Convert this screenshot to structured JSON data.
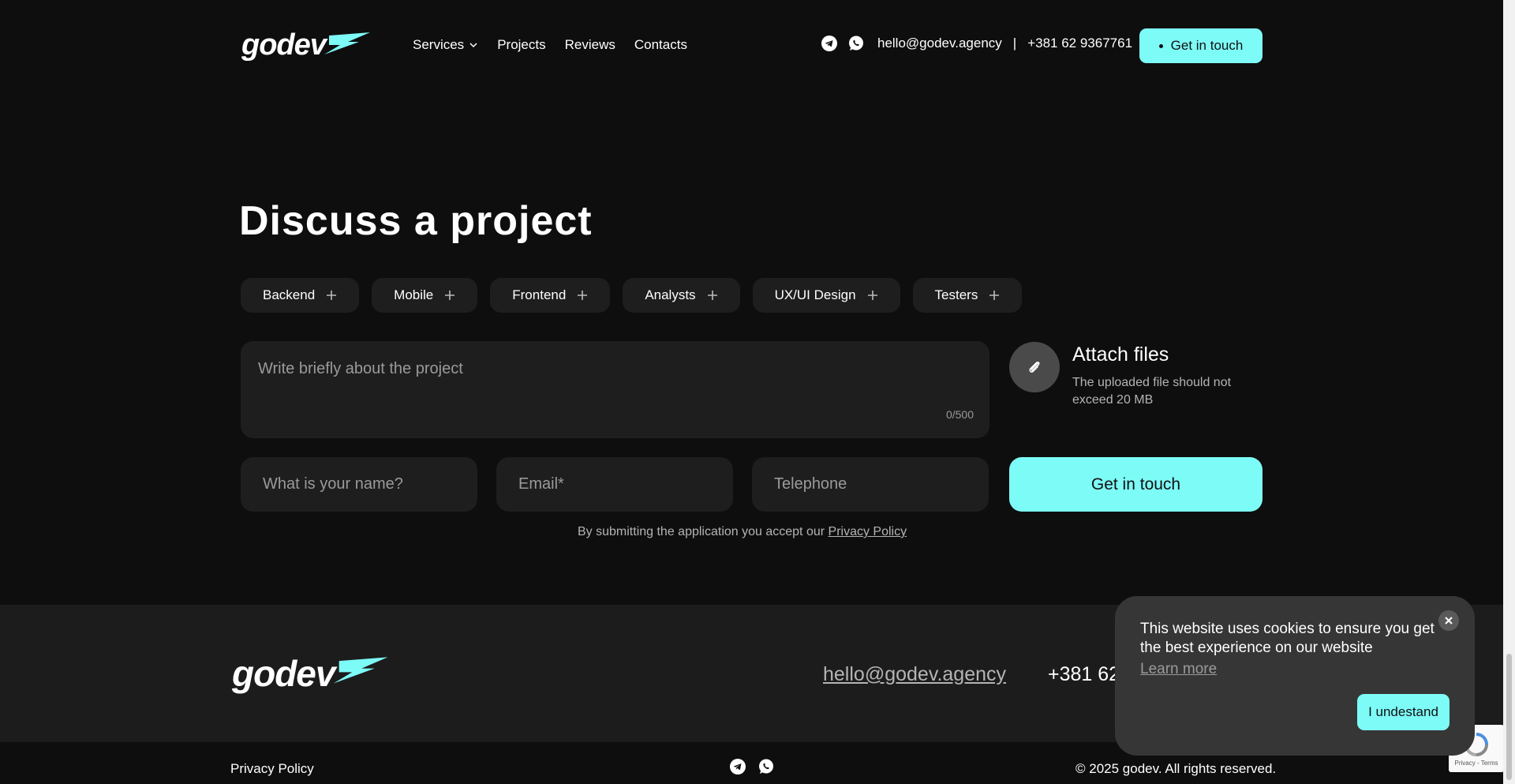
{
  "header": {
    "logo_text": "godev",
    "nav": [
      {
        "label": "Services",
        "has_dropdown": true
      },
      {
        "label": "Projects"
      },
      {
        "label": "Reviews"
      },
      {
        "label": "Contacts"
      }
    ],
    "email": "hello@godev.agency",
    "separator": "|",
    "phone": "+381 62 9367761",
    "cta_label": "Get in touch",
    "social_icons": [
      "telegram-icon",
      "whatsapp-icon"
    ]
  },
  "discuss": {
    "title": "Discuss a project",
    "chips": [
      "Backend",
      "Mobile",
      "Frontend",
      "Analysts",
      "UX/UI Design",
      "Testers"
    ],
    "project_placeholder": "Write briefly about the project",
    "counter": "0/500",
    "attach_title": "Attach files",
    "attach_note": "The uploaded file should not exceed 20 MB",
    "name_placeholder": "What is your name?",
    "email_placeholder": "Email*",
    "phone_placeholder": "Telephone",
    "submit_label": "Get in touch",
    "consent_text": "By submitting the application you accept our ",
    "consent_link": "Privacy Policy"
  },
  "footer": {
    "logo_text": "godev",
    "email": "hello@godev.agency",
    "phone": "+381 62",
    "privacy": "Privacy Policy",
    "copyright": "© 2025 godev. All rights reserved."
  },
  "cookie": {
    "message": "This website uses cookies to ensure you get the best experience on our website",
    "learn_more": "Learn more",
    "accept": "I undestand"
  },
  "recaptcha": {
    "text": "Privacy - Terms"
  },
  "colors": {
    "accent": "#7dfbf7",
    "background": "#0e0e0e",
    "surface": "#1e1e1e"
  }
}
